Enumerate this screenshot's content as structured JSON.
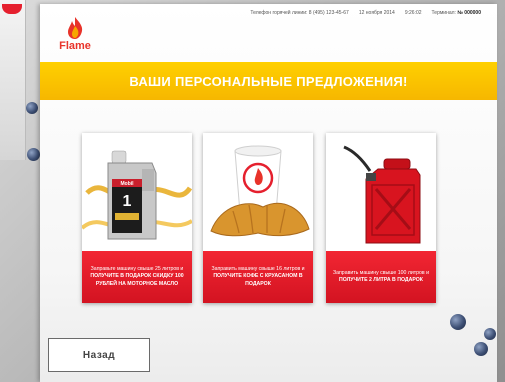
{
  "status_bar": {
    "hotline": "Телефон горячей линии: 8 (495) 123-45-67",
    "date": "12 ноября 2014",
    "time": "9:26:02",
    "terminal_label": "Терминал:",
    "terminal_number": "№ 000000"
  },
  "brand": {
    "name": "Flame"
  },
  "banner": {
    "title": "ВАШИ ПЕРСОНАЛЬНЫЕ ПРЕДЛОЖЕНИЯ!"
  },
  "offers": [
    {
      "image": "motor-oil-canister",
      "line1": "Заправьте машину свыше 25 литров и",
      "line2": "ПОЛУЧИТЕ В ПОДАРОК СКИДКУ 100 РУБЛЕЙ НА МОТОРНОЕ МАСЛО"
    },
    {
      "image": "coffee-and-croissant",
      "line1": "Заправить машину свыше 16 литров и",
      "line2": "ПОЛУЧИТЕ КОФЕ С КРУАСАНОМ В ПОДАРОК"
    },
    {
      "image": "red-fuel-jerrycan",
      "line1": "Заправить машину свыше 100 литров и",
      "line2": "ПОЛУЧИТЕ 2 ЛИТРА В ПОДАРОК"
    }
  ],
  "buttons": {
    "back": "Назад"
  },
  "colors": {
    "accent_yellow": "#ffcc00",
    "accent_red": "#e5202e",
    "brand_red": "#e8332a"
  }
}
